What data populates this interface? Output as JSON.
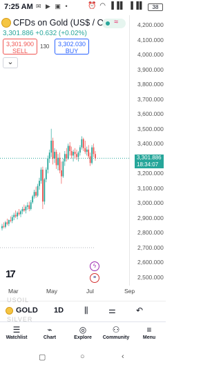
{
  "status_bar": {
    "time": "7:25 AM",
    "left_icons": [
      "mail-icon",
      "youtube-icon",
      "gallery-icon",
      "dot"
    ],
    "right_icons": [
      "alarm-icon",
      "wifi-icon",
      "signal-icon"
    ],
    "battery": "38"
  },
  "symbol": {
    "title": "CFDs on Gold (US$ / OZ)",
    "price": "3,301.886",
    "change": "+0.632 (+0.02%)",
    "status_color": "#26a69a"
  },
  "trade": {
    "sell_price": "3,301.900",
    "sell_label": "SELL",
    "spread": "130",
    "buy_price": "3,302.030",
    "buy_label": "BUY"
  },
  "price_axis": {
    "ticks": [
      "4,200.000",
      "4,100.000",
      "4,000.000",
      "3,900.000",
      "3,800.000",
      "3,700.000",
      "3,600.000",
      "3,500.000",
      "3,400.000",
      "3,300.000",
      "3,200.000",
      "3,100.000",
      "3,000.000",
      "2,900.000",
      "2,800.000",
      "2,700.000",
      "2,600.000",
      "2,500.000"
    ],
    "last_price": "3,301.886",
    "countdown": "18:34:07"
  },
  "time_axis": {
    "months": [
      "Mar",
      "May",
      "Jul",
      "Sep"
    ]
  },
  "chart_data": {
    "type": "candlestick",
    "x_range": [
      "Feb",
      "Sep"
    ],
    "ylim": [
      2450,
      4250
    ],
    "last_price": 3301.886,
    "reference_level": 2700,
    "colors": {
      "up": "#26a69a",
      "down": "#ef5350"
    },
    "candles": [
      {
        "o": 2830,
        "h": 2860,
        "l": 2815,
        "c": 2845
      },
      {
        "o": 2845,
        "h": 2870,
        "l": 2830,
        "c": 2840
      },
      {
        "o": 2840,
        "h": 2880,
        "l": 2830,
        "c": 2870
      },
      {
        "o": 2870,
        "h": 2895,
        "l": 2850,
        "c": 2860
      },
      {
        "o": 2860,
        "h": 2890,
        "l": 2845,
        "c": 2885
      },
      {
        "o": 2885,
        "h": 2910,
        "l": 2870,
        "c": 2880
      },
      {
        "o": 2880,
        "h": 2920,
        "l": 2865,
        "c": 2905
      },
      {
        "o": 2905,
        "h": 2935,
        "l": 2885,
        "c": 2920
      },
      {
        "o": 2920,
        "h": 2950,
        "l": 2900,
        "c": 2910
      },
      {
        "o": 2910,
        "h": 2945,
        "l": 2890,
        "c": 2935
      },
      {
        "o": 2935,
        "h": 2960,
        "l": 2915,
        "c": 2925
      },
      {
        "o": 2925,
        "h": 2955,
        "l": 2905,
        "c": 2945
      },
      {
        "o": 2945,
        "h": 2975,
        "l": 2925,
        "c": 2960
      },
      {
        "o": 2960,
        "h": 2990,
        "l": 2940,
        "c": 2950
      },
      {
        "o": 2950,
        "h": 2985,
        "l": 2930,
        "c": 2975
      },
      {
        "o": 2975,
        "h": 3005,
        "l": 2955,
        "c": 2985
      },
      {
        "o": 2985,
        "h": 3010,
        "l": 2945,
        "c": 2960
      },
      {
        "o": 2960,
        "h": 3020,
        "l": 2950,
        "c": 3005
      },
      {
        "o": 3005,
        "h": 3055,
        "l": 2995,
        "c": 3045
      },
      {
        "o": 3045,
        "h": 3090,
        "l": 3030,
        "c": 3075
      },
      {
        "o": 3075,
        "h": 3110,
        "l": 3035,
        "c": 3050
      },
      {
        "o": 3050,
        "h": 3130,
        "l": 3040,
        "c": 3115
      },
      {
        "o": 3115,
        "h": 3170,
        "l": 3090,
        "c": 3150
      },
      {
        "o": 3150,
        "h": 3240,
        "l": 3130,
        "c": 3225
      },
      {
        "o": 3225,
        "h": 3245,
        "l": 2960,
        "c": 3010
      },
      {
        "o": 3010,
        "h": 3170,
        "l": 2990,
        "c": 3160
      },
      {
        "o": 3160,
        "h": 3240,
        "l": 3140,
        "c": 3225
      },
      {
        "o": 3225,
        "h": 3320,
        "l": 3200,
        "c": 3300
      },
      {
        "o": 3300,
        "h": 3360,
        "l": 3270,
        "c": 3340
      },
      {
        "o": 3340,
        "h": 3500,
        "l": 3310,
        "c": 3420
      },
      {
        "o": 3420,
        "h": 3440,
        "l": 3260,
        "c": 3300
      },
      {
        "o": 3300,
        "h": 3370,
        "l": 3270,
        "c": 3345
      },
      {
        "o": 3345,
        "h": 3360,
        "l": 3230,
        "c": 3255
      },
      {
        "o": 3255,
        "h": 3330,
        "l": 3220,
        "c": 3305
      },
      {
        "o": 3305,
        "h": 3340,
        "l": 3200,
        "c": 3220
      },
      {
        "o": 3220,
        "h": 3280,
        "l": 3130,
        "c": 3180
      },
      {
        "o": 3180,
        "h": 3300,
        "l": 3170,
        "c": 3280
      },
      {
        "o": 3280,
        "h": 3350,
        "l": 3250,
        "c": 3330
      },
      {
        "o": 3330,
        "h": 3370,
        "l": 3280,
        "c": 3300
      },
      {
        "o": 3300,
        "h": 3400,
        "l": 3290,
        "c": 3385
      },
      {
        "o": 3385,
        "h": 3410,
        "l": 3320,
        "c": 3350
      },
      {
        "o": 3350,
        "h": 3380,
        "l": 3300,
        "c": 3320
      },
      {
        "o": 3320,
        "h": 3360,
        "l": 3280,
        "c": 3345
      },
      {
        "o": 3345,
        "h": 3370,
        "l": 3300,
        "c": 3330
      },
      {
        "o": 3330,
        "h": 3360,
        "l": 3290,
        "c": 3310
      },
      {
        "o": 3310,
        "h": 3350,
        "l": 3280,
        "c": 3340
      },
      {
        "o": 3340,
        "h": 3390,
        "l": 3320,
        "c": 3375
      },
      {
        "o": 3375,
        "h": 3450,
        "l": 3360,
        "c": 3430
      },
      {
        "o": 3430,
        "h": 3440,
        "l": 3350,
        "c": 3370
      },
      {
        "o": 3370,
        "h": 3420,
        "l": 3330,
        "c": 3345
      },
      {
        "o": 3345,
        "h": 3380,
        "l": 3320,
        "c": 3360
      },
      {
        "o": 3360,
        "h": 3390,
        "l": 3300,
        "c": 3315
      },
      {
        "o": 3315,
        "h": 3340,
        "l": 3250,
        "c": 3270
      },
      {
        "o": 3270,
        "h": 3390,
        "l": 3260,
        "c": 3375
      },
      {
        "o": 3375,
        "h": 3400,
        "l": 3310,
        "c": 3330
      },
      {
        "o": 3330,
        "h": 3350,
        "l": 3285,
        "c": 3301.886
      }
    ]
  },
  "side_icons": [
    "lightning-icon",
    "us-flag-icon"
  ],
  "bottom_toolbar": {
    "ghost_above": "USOIL",
    "symbol": "GOLD",
    "interval": "1D",
    "ghost_below": "SILVER"
  },
  "nav": [
    {
      "id": "watchlist",
      "label": "Watchlist",
      "icon": "☰"
    },
    {
      "id": "chart",
      "label": "Chart",
      "icon": "⌁"
    },
    {
      "id": "explore",
      "label": "Explore",
      "icon": "◎"
    },
    {
      "id": "community",
      "label": "Community",
      "icon": "⚇"
    },
    {
      "id": "menu",
      "label": "Menu",
      "icon": "≡"
    }
  ],
  "system_nav": [
    "recents-icon",
    "home-icon",
    "back-icon"
  ]
}
